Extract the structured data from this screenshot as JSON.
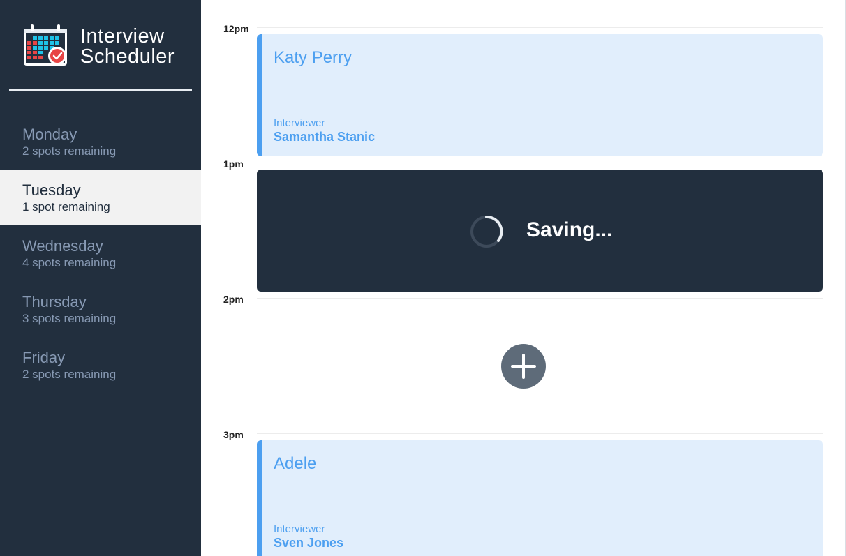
{
  "app": {
    "title_line1": "Interview",
    "title_line2": "Scheduler",
    "logo_icon": "calendar-check-icon"
  },
  "sidebar": {
    "days": [
      {
        "name": "Monday",
        "spots": "2 spots remaining",
        "selected": false
      },
      {
        "name": "Tuesday",
        "spots": "1 spot remaining",
        "selected": true
      },
      {
        "name": "Wednesday",
        "spots": "4 spots remaining",
        "selected": false
      },
      {
        "name": "Thursday",
        "spots": "3 spots remaining",
        "selected": false
      },
      {
        "name": "Friday",
        "spots": "2 spots remaining",
        "selected": false
      }
    ]
  },
  "schedule": {
    "slots": [
      {
        "time": "12pm",
        "status": "booked",
        "student": "Katy Perry",
        "interviewer_label": "Interviewer",
        "interviewer": "Samantha Stanic"
      },
      {
        "time": "1pm",
        "status": "saving",
        "message": "Saving..."
      },
      {
        "time": "2pm",
        "status": "empty",
        "add_icon": "plus-icon"
      },
      {
        "time": "3pm",
        "status": "booked",
        "student": "Adele",
        "interviewer_label": "Interviewer",
        "interviewer": "Sven Jones"
      }
    ]
  },
  "colors": {
    "sidebar_bg": "#222f3e",
    "selected_day_bg": "#f2f2f2",
    "appointment_bg": "#e1eefc",
    "accent": "#4c9ff0",
    "add_button": "#5e6b79"
  }
}
